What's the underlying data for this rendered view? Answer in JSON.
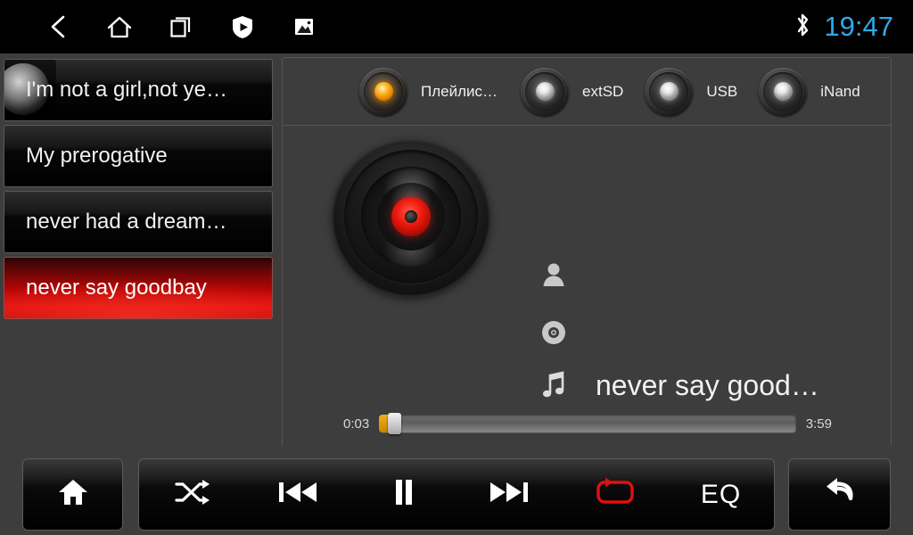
{
  "statusbar": {
    "icons": [
      {
        "name": "back-icon",
        "label": "Back"
      },
      {
        "name": "home-icon",
        "label": "Home"
      },
      {
        "name": "recent-apps-icon",
        "label": "Recent apps"
      },
      {
        "name": "shield-play-icon",
        "label": "Security player"
      },
      {
        "name": "gallery-icon",
        "label": "Gallery"
      }
    ],
    "bluetooth_icon": "bluetooth-icon",
    "clock": "19:47",
    "clock_color": "#2fa8e8"
  },
  "playlist": {
    "items": [
      {
        "title": "I'm not a girl,not ye…",
        "selected": false,
        "ripple": true
      },
      {
        "title": "My prerogative",
        "selected": false,
        "ripple": false
      },
      {
        "title": "never had a dream…",
        "selected": false,
        "ripple": false
      },
      {
        "title": "never say goodbay",
        "selected": true,
        "ripple": false
      }
    ],
    "selected_color": "#d01010"
  },
  "sources": {
    "items": [
      {
        "label": "Плейлис…",
        "active": true
      },
      {
        "label": "extSD",
        "active": false
      },
      {
        "label": "USB",
        "active": false
      },
      {
        "label": "iNand",
        "active": false
      }
    ],
    "active_led_color": "#f0a005",
    "idle_led_color": "#e8e8e8"
  },
  "now_playing": {
    "album_art_icon": "vinyl-disc-icon",
    "artist_icon": "person-icon",
    "artist": "",
    "album_icon": "disc-icon",
    "album": "",
    "title_icon": "music-note-icon",
    "title": "never say good…"
  },
  "progress": {
    "elapsed": "0:03",
    "duration": "3:59",
    "percent": 1.3,
    "fill_color": "#e09c06"
  },
  "bottombar": {
    "home": {
      "label": "Home",
      "icon": "home-solid-icon"
    },
    "shuffle": {
      "label": "Shuffle",
      "icon": "shuffle-icon",
      "active": false
    },
    "previous": {
      "label": "Previous",
      "icon": "previous-track-icon"
    },
    "playpause": {
      "label": "Pause",
      "icon": "pause-icon"
    },
    "next": {
      "label": "Next",
      "icon": "next-track-icon"
    },
    "repeat": {
      "label": "Repeat",
      "icon": "repeat-icon",
      "active": true,
      "color": "#e01010"
    },
    "eq": {
      "label": "EQ",
      "icon": "equalizer-label"
    },
    "back": {
      "label": "Back",
      "icon": "return-arrow-icon"
    }
  }
}
